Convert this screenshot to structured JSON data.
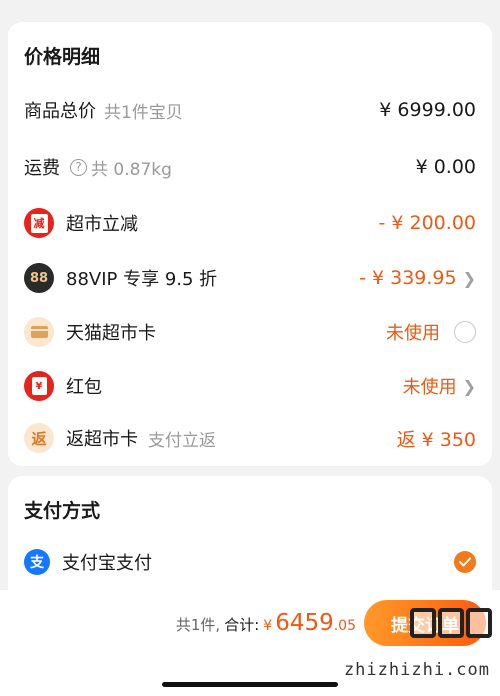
{
  "price_section": {
    "title": "价格明细",
    "total_label": "商品总价",
    "total_sub": "共1件宝贝",
    "total_value": "¥ 6999.00",
    "shipping_label": "运费",
    "shipping_sub": "共 0.87kg",
    "shipping_value": "¥ 0.00",
    "supermarket_label": "超市立减",
    "supermarket_icon_char": "减",
    "supermarket_value": "- ¥ 200.00",
    "vip_label": "88VIP 专享 9.5 折",
    "vip_icon_char": "88",
    "vip_value": "- ¥ 339.95",
    "card_label": "天猫超市卡",
    "card_value": "未使用",
    "redpack_label": "红包",
    "redpack_icon_char": "¥",
    "redpack_value": "未使用",
    "rebate_label": "返超市卡",
    "rebate_icon_char": "返",
    "rebate_sub": "支付立返",
    "rebate_value": "返 ¥ 350"
  },
  "payment_section": {
    "title": "支付方式",
    "alipay_icon_char": "支",
    "alipay_label": "支付宝支付",
    "alipay_selected": true
  },
  "bottom_bar": {
    "count_text": "共1件,",
    "total_label": "合计:",
    "currency": "¥",
    "total_int": "6459",
    "total_dec": ".05",
    "submit_label": "提交订单"
  },
  "watermark": {
    "logo_text": "值值值",
    "url_text": "zhizhizhi.com"
  },
  "colors": {
    "accent": "#ee5a14",
    "red_icon": "#e8231a",
    "alipay_blue": "#1677ff",
    "check_orange": "#f07a1c"
  }
}
